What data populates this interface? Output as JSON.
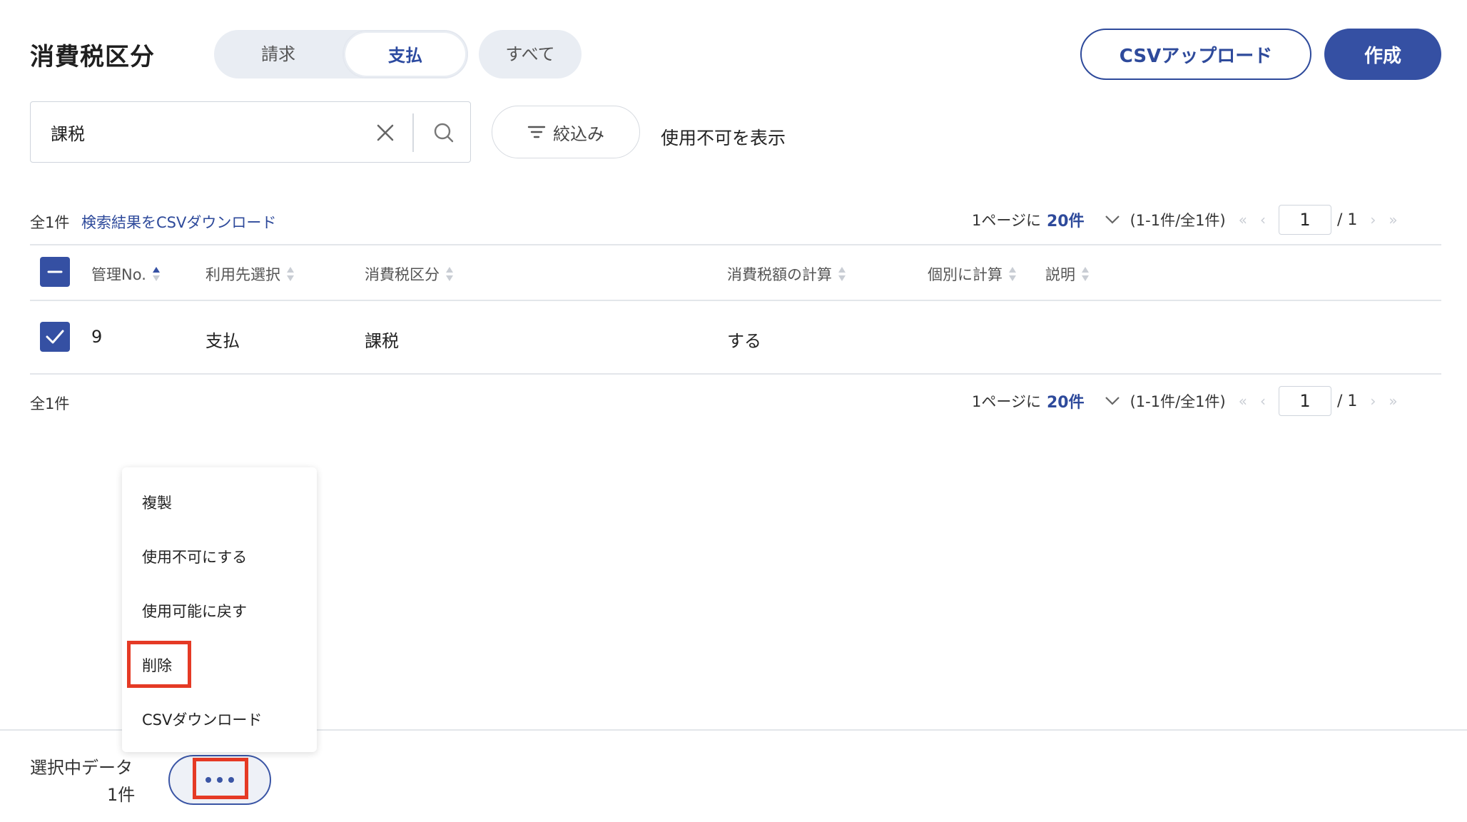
{
  "header": {
    "title": "消費税区分",
    "tabs": [
      {
        "label": "請求",
        "active": false
      },
      {
        "label": "支払",
        "active": true
      },
      {
        "label": "すべて",
        "active": false
      }
    ],
    "csv_upload_label": "CSVアップロード",
    "create_label": "作成"
  },
  "search": {
    "value": "課税",
    "filter_label": "絞込み",
    "show_disabled_label": "使用不可を表示"
  },
  "results": {
    "total_label": "全1件",
    "csv_download_link": "検索結果をCSVダウンロード",
    "pager": {
      "per_page_prefix": "1ページに",
      "per_page_value": "20件",
      "range": "(1-1件/全1件)",
      "current_page": "1",
      "total_pages": "/ 1"
    }
  },
  "table": {
    "columns": [
      "管理No.",
      "利用先選択",
      "消費税区分",
      "消費税額の計算",
      "個別に計算",
      "説明"
    ],
    "rows": [
      {
        "no": "9",
        "target": "支払",
        "tax_category": "課税",
        "tax_calc": "する",
        "individual": "",
        "description": ""
      }
    ]
  },
  "footer": {
    "total_label": "全1件"
  },
  "context_menu": {
    "items": [
      "複製",
      "使用不可にする",
      "使用可能に戻す",
      "削除",
      "CSVダウンロード"
    ]
  },
  "bottom_bar": {
    "selected_label": "選択中データ",
    "selected_count": "1件"
  },
  "colors": {
    "accent": "#3550a3",
    "highlight": "#e53a25",
    "segment_bg": "#e9edf3"
  }
}
